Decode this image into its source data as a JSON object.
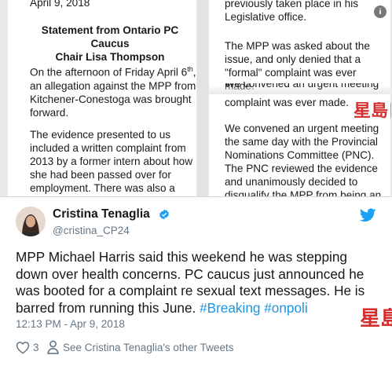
{
  "statement": {
    "date": "April 9, 2018",
    "title_line1": "Statement from Ontario PC Caucus",
    "title_line2": "Chair Lisa Thompson",
    "p1_a": "On the afternoon of Friday April 6",
    "p1_sup": "th",
    "p1_b": ", an allegation against the MPP from Kitchener-Conestoga was brought forward.",
    "p2": "The evidence presented to us included a written complaint from 2013 by a former intern about how she had been passed over for employment. There was also a series of text messages from the same time period, between"
  },
  "statement_right": {
    "r1": "previously taken place in his Legislative office.",
    "r2": "The MPP was asked about the issue, and only denied that a \"formal\" complaint was ever made.",
    "r3a": "We convened an urgent meeting the",
    "r3": "complaint was ever made.",
    "r4": "We convened an urgent meeting the same day with the Provincial Nominations Committee (PNC). The PNC reviewed the evidence and unanimously decided to disqualify the MPP from being an Ontario PC"
  },
  "tweet": {
    "name": "Cristina Tenaglia",
    "handle": "@cristina_CP24",
    "text": "MPP Michael Harris said this weekend he was stepping down over health concerns. PC caucus just announced he was booted for a complaint re sexual text messages. He is barred from running this June. ",
    "hashtag1": "#Breaking",
    "hashtag2": "#onpoli",
    "timestamp": "12:13 PM - Apr 9, 2018",
    "likes": "3",
    "other_tweets": "See Cristina Tenaglia's other Tweets"
  },
  "watermark": {
    "text": "星島日報"
  },
  "icons": {
    "info": "info-icon",
    "verified": "verified-badge-icon",
    "bird": "twitter-bird-icon",
    "heart": "heart-icon",
    "person": "person-icon"
  },
  "colors": {
    "link": "#1b95e0",
    "secondary_text": "#657786",
    "primary_text": "#14171a",
    "watermark": "#d32f2f"
  }
}
